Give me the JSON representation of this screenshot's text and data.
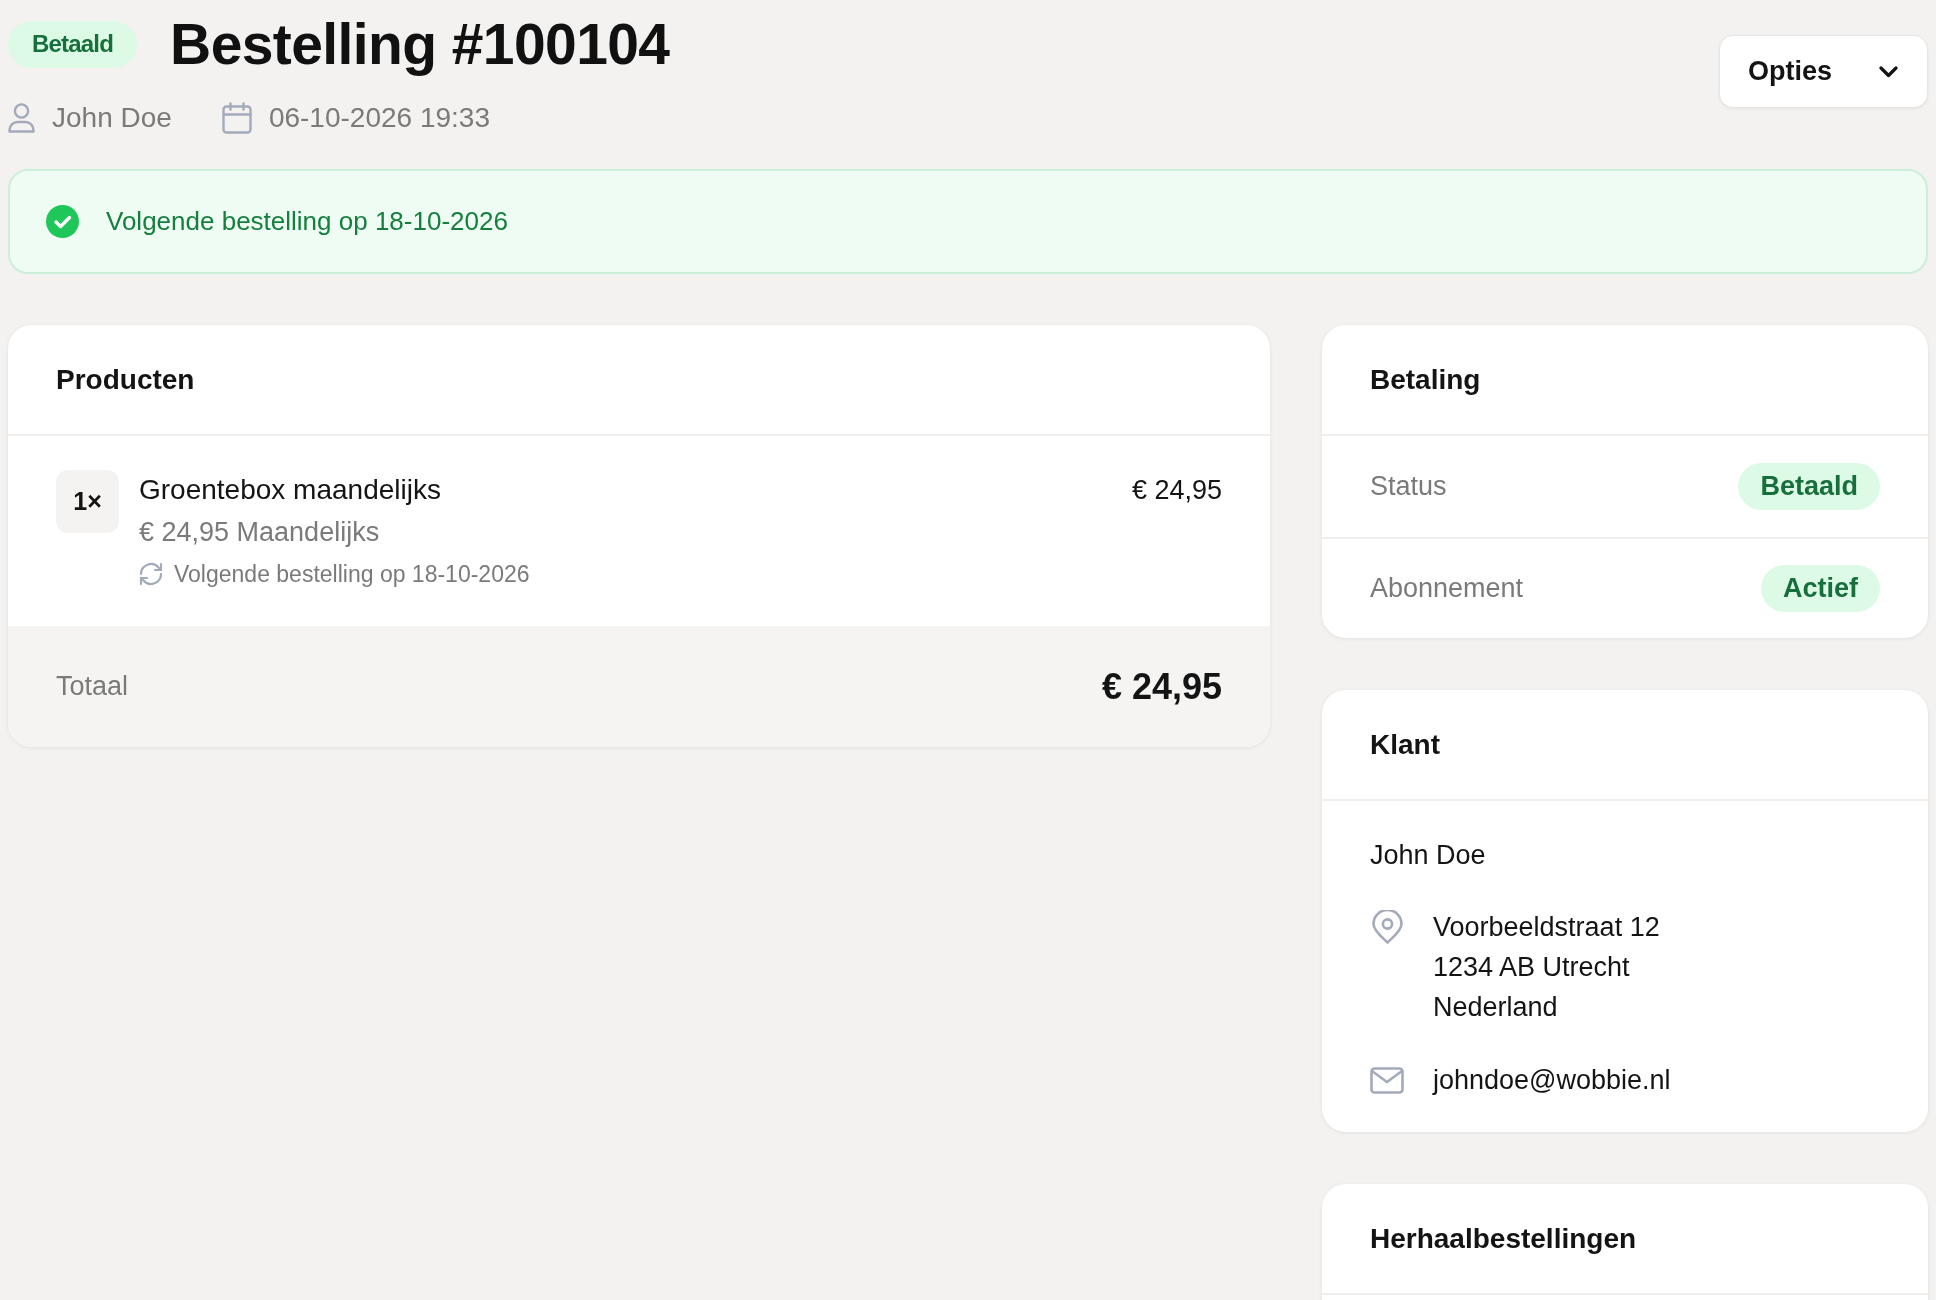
{
  "header": {
    "status_badge": "Betaald",
    "title": "Bestelling #100104",
    "customer": "John Doe",
    "date": "06-10-2026 19:33",
    "options_button": "Opties"
  },
  "banner": {
    "text": "Volgende bestelling op 18-10-2026"
  },
  "products": {
    "title": "Producten",
    "items": [
      {
        "quantity": "1×",
        "name": "Groentebox maandelijks",
        "price_line": "€ 24,95 Maandelijks",
        "next_order": "Volgende bestelling op 18-10-2026",
        "price": "€ 24,95"
      }
    ],
    "total_label": "Totaal",
    "total": "€ 24,95"
  },
  "payment": {
    "title": "Betaling",
    "rows": [
      {
        "label": "Status",
        "value": "Betaald"
      },
      {
        "label": "Abonnement",
        "value": "Actief"
      }
    ]
  },
  "customer": {
    "title": "Klant",
    "name": "John Doe",
    "address": [
      "Voorbeeldstraat 12",
      "1234 AB Utrecht",
      "Nederland"
    ],
    "email": "johndoe@wobbie.nl"
  },
  "repeat_orders": {
    "title": "Herhaalbestellingen"
  }
}
